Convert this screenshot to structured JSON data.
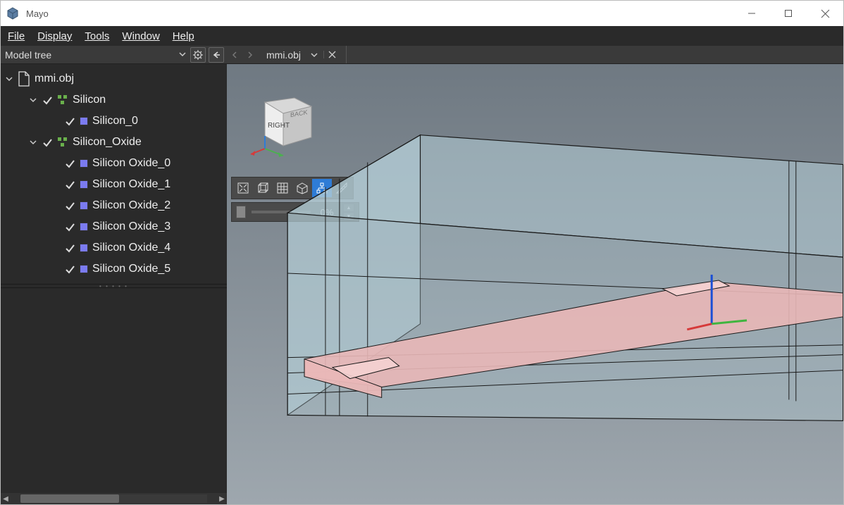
{
  "window": {
    "title": "Mayo"
  },
  "menu": {
    "file": "File",
    "display": "Display",
    "tools": "Tools",
    "window": "Window",
    "help": "Help"
  },
  "panel": {
    "model_tree_label": "Model tree"
  },
  "tab": {
    "name": "mmi.obj"
  },
  "tree": {
    "root": "mmi.obj",
    "silicon": "Silicon",
    "silicon_0": "Silicon_0",
    "silicon_oxide": "Silicon_Oxide",
    "silicon_oxide_0": "Silicon Oxide_0",
    "silicon_oxide_1": "Silicon Oxide_1",
    "silicon_oxide_2": "Silicon Oxide_2",
    "silicon_oxide_3": "Silicon Oxide_3",
    "silicon_oxide_4": "Silicon Oxide_4",
    "silicon_oxide_5": "Silicon Oxide_5"
  },
  "viewcube": {
    "face1": "RIGHT",
    "face2": "BACK"
  },
  "slider": {
    "value": "0%"
  },
  "colors": {
    "silicon": "#e9b7b7",
    "oxide": "#bcd1da",
    "accent": "#2e7cd6"
  }
}
